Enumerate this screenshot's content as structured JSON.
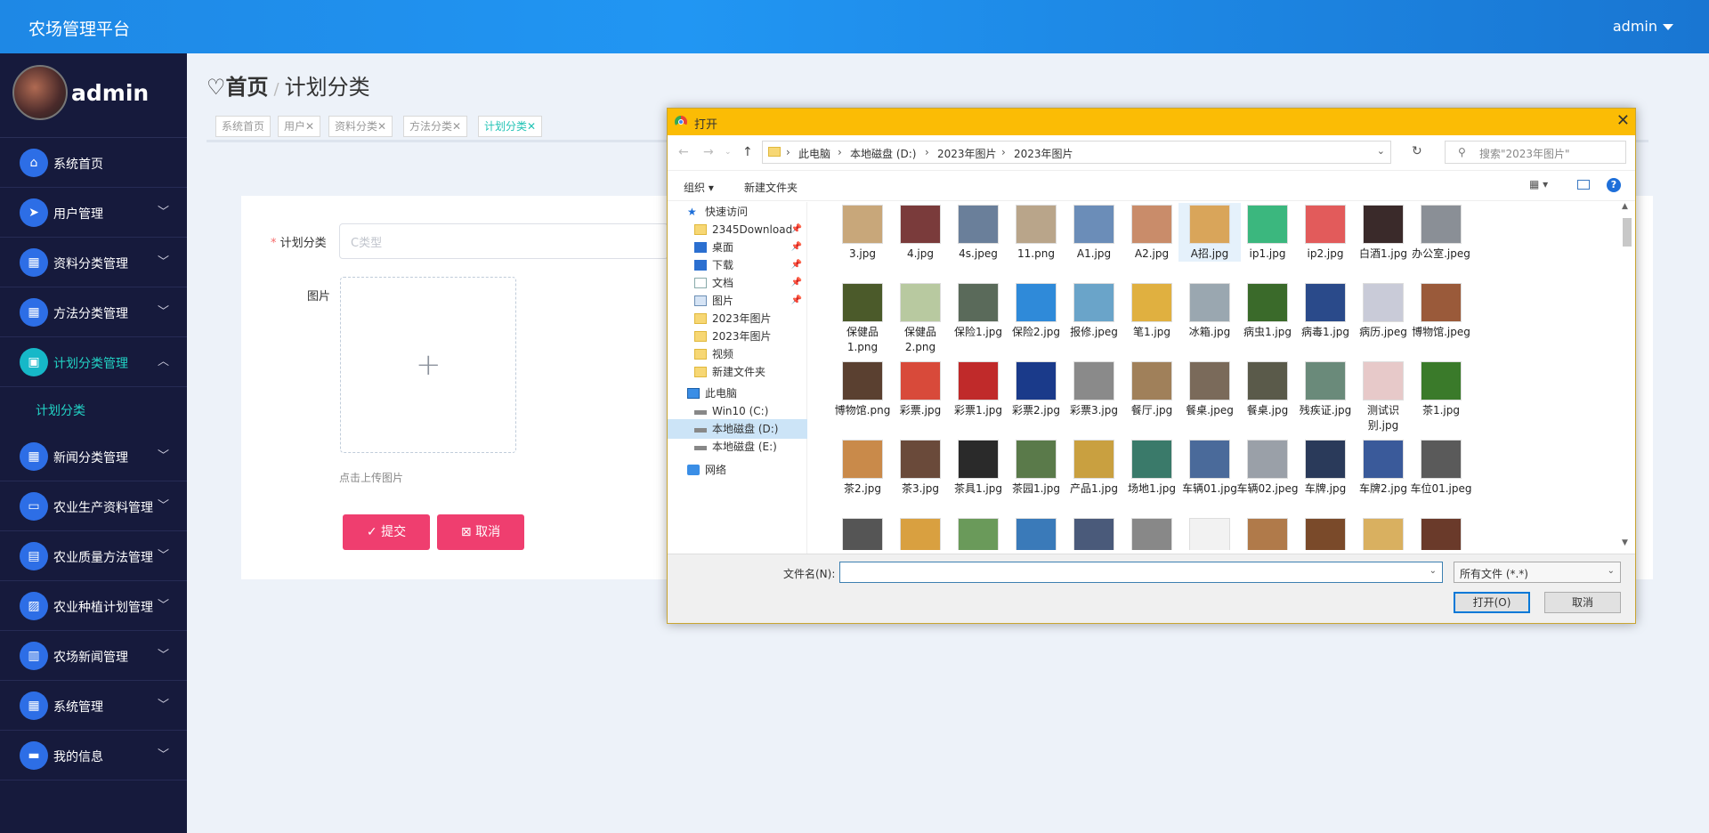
{
  "app": {
    "title": "农场管理平台",
    "user": "admin"
  },
  "sidebar": {
    "username": "admin",
    "items": [
      {
        "label": "系统首页",
        "icon": "home-icon",
        "glyph": "⌂"
      },
      {
        "label": "用户管理",
        "icon": "send-icon",
        "glyph": "➤"
      },
      {
        "label": "资料分类管理",
        "icon": "grid-icon",
        "glyph": "▦"
      },
      {
        "label": "方法分类管理",
        "icon": "grid-icon",
        "glyph": "▦"
      },
      {
        "label": "计划分类管理",
        "icon": "calendar-icon",
        "glyph": "▣"
      },
      {
        "label": "新闻分类管理",
        "icon": "grid-icon",
        "glyph": "▦"
      },
      {
        "label": "农业生产资料管理",
        "icon": "monitor-icon",
        "glyph": "▭"
      },
      {
        "label": "农业质量方法管理",
        "icon": "clipboard-icon",
        "glyph": "▤"
      },
      {
        "label": "农业种植计划管理",
        "icon": "chart-icon",
        "glyph": "▨"
      },
      {
        "label": "农场新闻管理",
        "icon": "book-icon",
        "glyph": "▥"
      },
      {
        "label": "系统管理",
        "icon": "grid-icon",
        "glyph": "▦"
      },
      {
        "label": "我的信息",
        "icon": "card-icon",
        "glyph": "▬"
      }
    ],
    "sub_item": "计划分类"
  },
  "breadcrumb": {
    "home": "首页",
    "sep": "/",
    "current": "计划分类"
  },
  "tags": [
    "系统首页",
    "用户✕",
    "资料分类✕",
    "方法分类✕",
    "计划分类✕"
  ],
  "form": {
    "category_label": "计划分类",
    "required_mark": "*",
    "category_placeholder": "C类型",
    "image_label": "图片",
    "upload_tip": "点击上传图片",
    "submit": "提交",
    "cancel": "取消"
  },
  "dialog": {
    "title": "打开",
    "path": [
      "此电脑",
      "本地磁盘 (D:)",
      "2023年图片",
      "2023年图片"
    ],
    "search_placeholder": "搜索\"2023年图片\"",
    "organize": "组织 ▾",
    "new_folder": "新建文件夹",
    "tree": [
      {
        "label": "快速访问",
        "icon": "star",
        "pin": false
      },
      {
        "label": "2345Download",
        "icon": "folder",
        "pin": true
      },
      {
        "label": "桌面",
        "icon": "blue",
        "pin": true
      },
      {
        "label": "下载",
        "icon": "blue",
        "pin": true
      },
      {
        "label": "文档",
        "icon": "doc",
        "pin": true
      },
      {
        "label": "图片",
        "icon": "pic",
        "pin": true
      },
      {
        "label": "2023年图片",
        "icon": "folder",
        "pin": false
      },
      {
        "label": "2023年图片",
        "icon": "folder",
        "pin": false
      },
      {
        "label": "视频",
        "icon": "folder",
        "pin": false
      },
      {
        "label": "新建文件夹",
        "icon": "folder",
        "pin": false
      },
      {
        "label": "此电脑",
        "icon": "pc",
        "pin": false
      },
      {
        "label": "Win10 (C:)",
        "icon": "drive",
        "pin": false
      },
      {
        "label": "本地磁盘 (D:)",
        "icon": "drive",
        "pin": false
      },
      {
        "label": "本地磁盘 (E:)",
        "icon": "drive",
        "pin": false
      },
      {
        "label": "网络",
        "icon": "net",
        "pin": false
      }
    ],
    "files": [
      [
        "3.jpg",
        "4.jpg",
        "4s.jpeg",
        "11.png",
        "A1.jpg",
        "A2.jpg",
        "A招.jpg",
        "ip1.jpg",
        "ip2.jpg",
        "白酒1.jpg",
        "办公室.jpeg"
      ],
      [
        "保健品1.png",
        "保健品2.png",
        "保险1.jpg",
        "保险2.jpg",
        "报修.jpeg",
        "笔1.jpg",
        "冰箱.jpg",
        "病虫1.jpg",
        "病毒1.jpg",
        "病历.jpeg",
        "博物馆.jpeg"
      ],
      [
        "博物馆.png",
        "彩票.jpg",
        "彩票1.jpg",
        "彩票2.jpg",
        "彩票3.jpg",
        "餐厅.jpg",
        "餐桌.jpeg",
        "餐桌.jpg",
        "残疾证.jpg",
        "测试识别.jpg",
        "茶1.jpg"
      ],
      [
        "茶2.jpg",
        "茶3.jpg",
        "茶具1.jpg",
        "茶园1.jpg",
        "产品1.jpg",
        "场地1.jpg",
        "车辆01.jpg",
        "车辆02.jpeg",
        "车牌.jpg",
        "车牌2.jpg",
        "车位01.jpeg"
      ]
    ],
    "thumb_colors": [
      [
        "#c8a77a",
        "#7a3b3b",
        "#6a7f9a",
        "#b9a58a",
        "#6b8db8",
        "#c98c6a",
        "#d9a55a",
        "#3bb77e",
        "#e25b5b",
        "#3a2a2a",
        "#8a8f96"
      ],
      [
        "#4b5a2a",
        "#b8c9a0",
        "#5a6a5a",
        "#2f8ad9",
        "#6aa4c9",
        "#e0b040",
        "#9aa7b0",
        "#3a6a2a",
        "#2a4a8a",
        "#c9cbd8",
        "#9a5a3a"
      ],
      [
        "#5a4030",
        "#d84a3a",
        "#c02a2a",
        "#1a3a8a",
        "#8a8a8a",
        "#a0805a",
        "#7a6a5a",
        "#5a5a4a",
        "#6a8a7a",
        "#e7c9c9",
        "#3a7a2a"
      ],
      [
        "#c98a4a",
        "#6a4a3a",
        "#2a2a2a",
        "#5a7a4a",
        "#c9a040",
        "#3a7a6a",
        "#4a6a9a",
        "#9aa0a8",
        "#2a3a5a",
        "#3a5a9a",
        "#5a5a5a"
      ]
    ],
    "filename_label": "文件名(N):",
    "filename_value": "",
    "filetype": "所有文件 (*.*)",
    "open": "打开(O)",
    "cancel": "取消"
  },
  "colors": {
    "accent": "#22d3c5",
    "primary_btn": "#ef3e6f",
    "dialog_title": "#fbbc05",
    "sidebar": "#161a3c",
    "topbar": "#1e88e5"
  }
}
